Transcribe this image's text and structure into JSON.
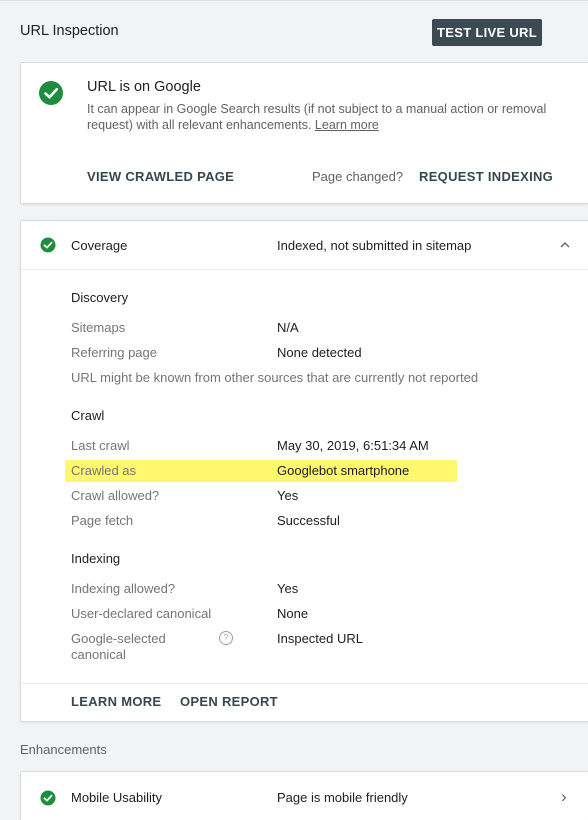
{
  "header": {
    "title": "URL Inspection",
    "test_live_label": "TEST LIVE URL"
  },
  "status_card": {
    "title": "URL is on Google",
    "description": "It can appear in Google Search results (if not subject to a manual action or removal request) with all relevant enhancements.",
    "learn_more": "Learn more",
    "view_crawled": "VIEW CRAWLED PAGE",
    "page_changed": "Page changed?",
    "request_indexing": "REQUEST INDEXING"
  },
  "coverage": {
    "label": "Coverage",
    "value": "Indexed, not submitted in sitemap",
    "expand_icon": "chevron-up-icon",
    "discovery": {
      "heading": "Discovery",
      "sitemaps_label": "Sitemaps",
      "sitemaps_value": "N/A",
      "referring_label": "Referring page",
      "referring_value": "None detected",
      "note": "URL might be known from other sources that are currently not reported"
    },
    "crawl": {
      "heading": "Crawl",
      "last_crawl_label": "Last crawl",
      "last_crawl_value": "May 30, 2019, 6:51:34 AM",
      "crawled_as_label": "Crawled as",
      "crawled_as_value": "Googlebot smartphone",
      "crawl_allowed_label": "Crawl allowed?",
      "crawl_allowed_value": "Yes",
      "page_fetch_label": "Page fetch",
      "page_fetch_value": "Successful"
    },
    "indexing": {
      "heading": "Indexing",
      "allowed_label": "Indexing allowed?",
      "allowed_value": "Yes",
      "user_canonical_label": "User-declared canonical",
      "user_canonical_value": "None",
      "google_canonical_label_1": "Google-selected",
      "google_canonical_label_2": "canonical",
      "help_glyph": "?",
      "google_canonical_value": "Inspected URL"
    },
    "learn_more": "LEARN MORE",
    "open_report": "OPEN REPORT"
  },
  "enhancements": {
    "section_label": "Enhancements",
    "mobile_label": "Mobile Usability",
    "mobile_value": "Page is mobile friendly",
    "chevron": "›"
  },
  "colors": {
    "success_green": "#1e8e3e",
    "highlight_yellow": "#fdf86d",
    "button_dark": "#3c4a52"
  }
}
